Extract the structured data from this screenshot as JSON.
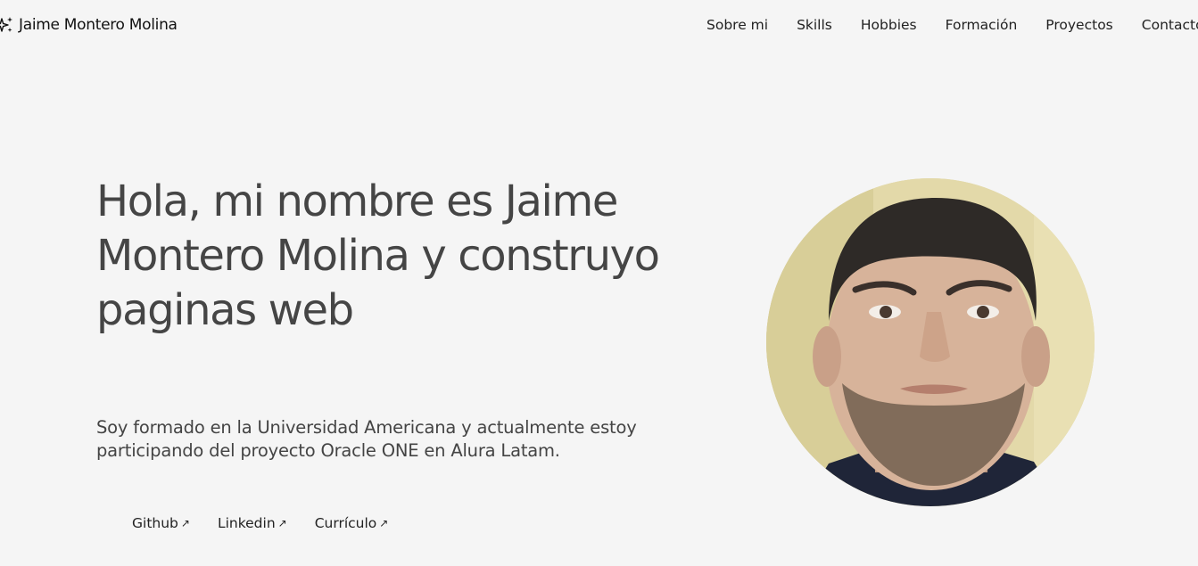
{
  "header": {
    "brand": "Jaime Montero Molina",
    "nav": [
      {
        "label": "Sobre mi"
      },
      {
        "label": "Skills"
      },
      {
        "label": "Hobbies"
      },
      {
        "label": "Formación"
      },
      {
        "label": "Proyectos"
      },
      {
        "label": "Contacto"
      }
    ]
  },
  "hero": {
    "title": "Hola, mi nombre es Jaime Montero Molina y construyo paginas web",
    "description": "Soy formado en la Universidad Americana y actualmente estoy participando del proyecto Oracle ONE en Alura Latam.",
    "links": [
      {
        "label": "Github",
        "icon": "arrow-up-right-icon"
      },
      {
        "label": "Linkedin",
        "icon": "arrow-up-right-icon"
      },
      {
        "label": "Currículo",
        "icon": "arrow-up-right-icon"
      }
    ],
    "photo": "profile-photo"
  },
  "colors": {
    "background": "#f5f5f5",
    "title": "#454545",
    "text": "#222222"
  }
}
